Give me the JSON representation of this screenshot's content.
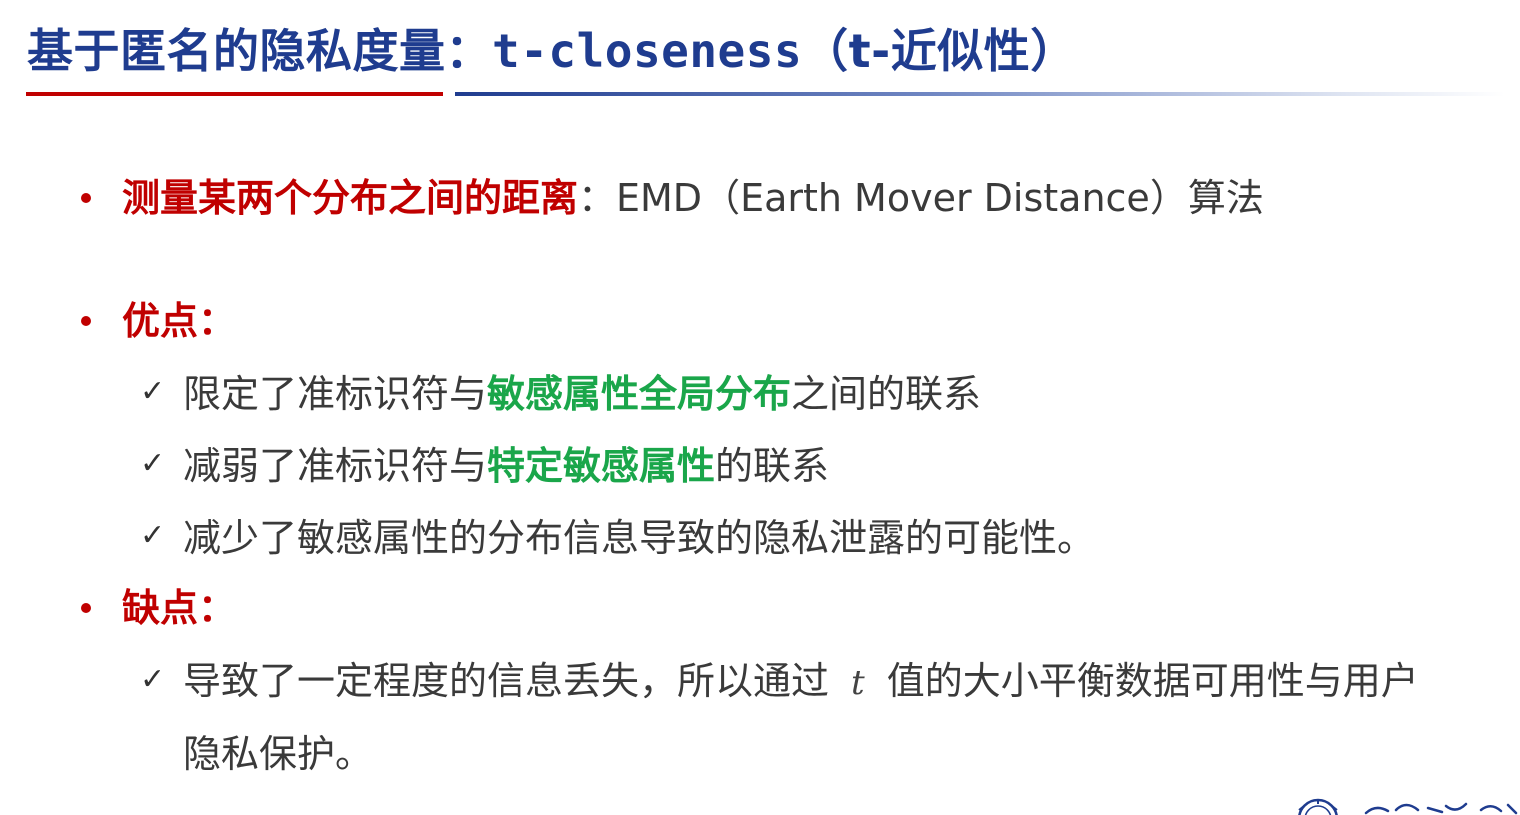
{
  "title": {
    "prefix": "基于匿名的隐私度量：",
    "term": "t-closeness",
    "suffix": "（t-近似性）"
  },
  "items": {
    "emd": {
      "highlight": "测量某两个分布之间的距离",
      "rest": "：EMD（Earth Mover Distance）算法"
    },
    "pros": {
      "heading": "优点：",
      "items": [
        {
          "pre": "限定了准标识符与",
          "hl": "敏感属性全局分布",
          "post": "之间的联系"
        },
        {
          "pre": "减弱了准标识符与",
          "hl": "特定敏感属性",
          "post": "的联系"
        },
        {
          "pre": "减少了敏感属性的分布信息导致的隐私泄露的可能性。",
          "hl": "",
          "post": ""
        }
      ]
    },
    "cons": {
      "heading": "缺点：",
      "items": [
        {
          "pre": "导致了一定程度的信息丢失，所以通过",
          "var": "t",
          "post": "值的大小平衡数据可用性与用户",
          "cont": "隐私保护。"
        }
      ]
    }
  },
  "check_glyph": "✓",
  "colors": {
    "title": "#1f3c8f",
    "red": "#c00000",
    "green": "#1aa64a",
    "text": "#3a3a3a"
  }
}
